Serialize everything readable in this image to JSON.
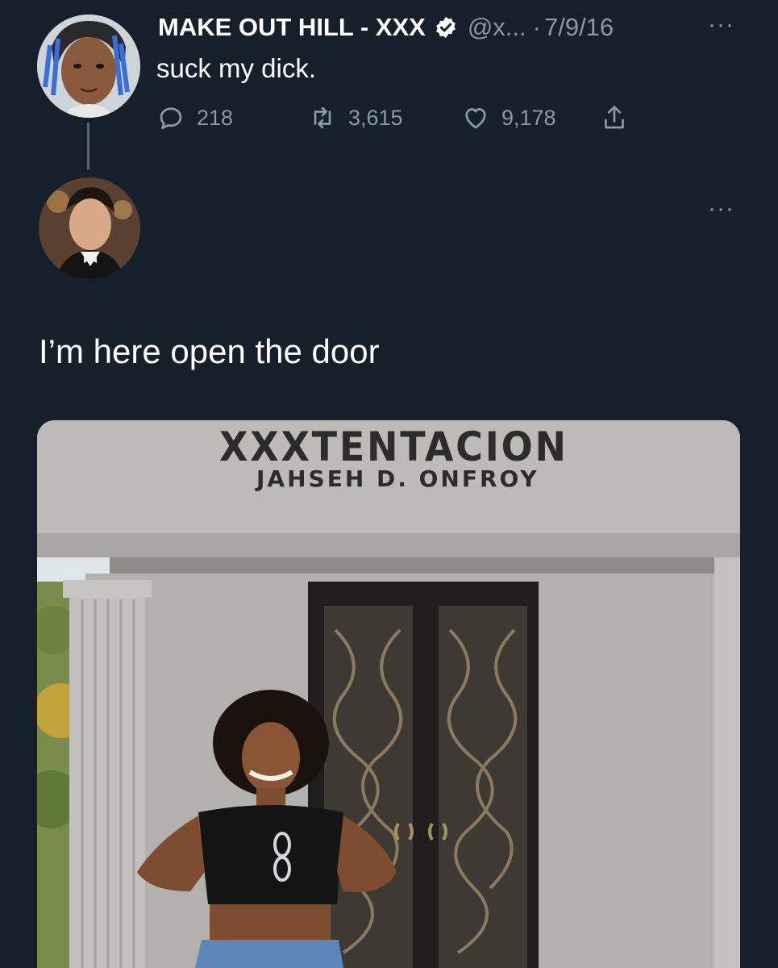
{
  "tweet": {
    "display_name": "MAKE OUT HILL - XXX",
    "handle": "@x...",
    "separator": "·",
    "date": "7/9/16",
    "more": "···",
    "text": "suck my dick.",
    "reply_count": "218",
    "retweet_count": "3,615",
    "like_count": "9,178"
  },
  "reply": {
    "more": "···",
    "text": "I’m here open the door",
    "photo": {
      "engraving_line1": "XXXTENTACION",
      "engraving_line2": "JAHSEH D. ONFROY"
    }
  },
  "icons": {
    "verified": "verified-badge-icon",
    "reply": "speech-bubble-icon",
    "retweet": "retweet-arrows-icon",
    "like": "heart-icon",
    "share": "share-upload-icon"
  },
  "colors": {
    "background": "#15202b",
    "primary_text": "#ffffff",
    "secondary_text": "#8b98a5",
    "thread_line": "#5b6570"
  }
}
